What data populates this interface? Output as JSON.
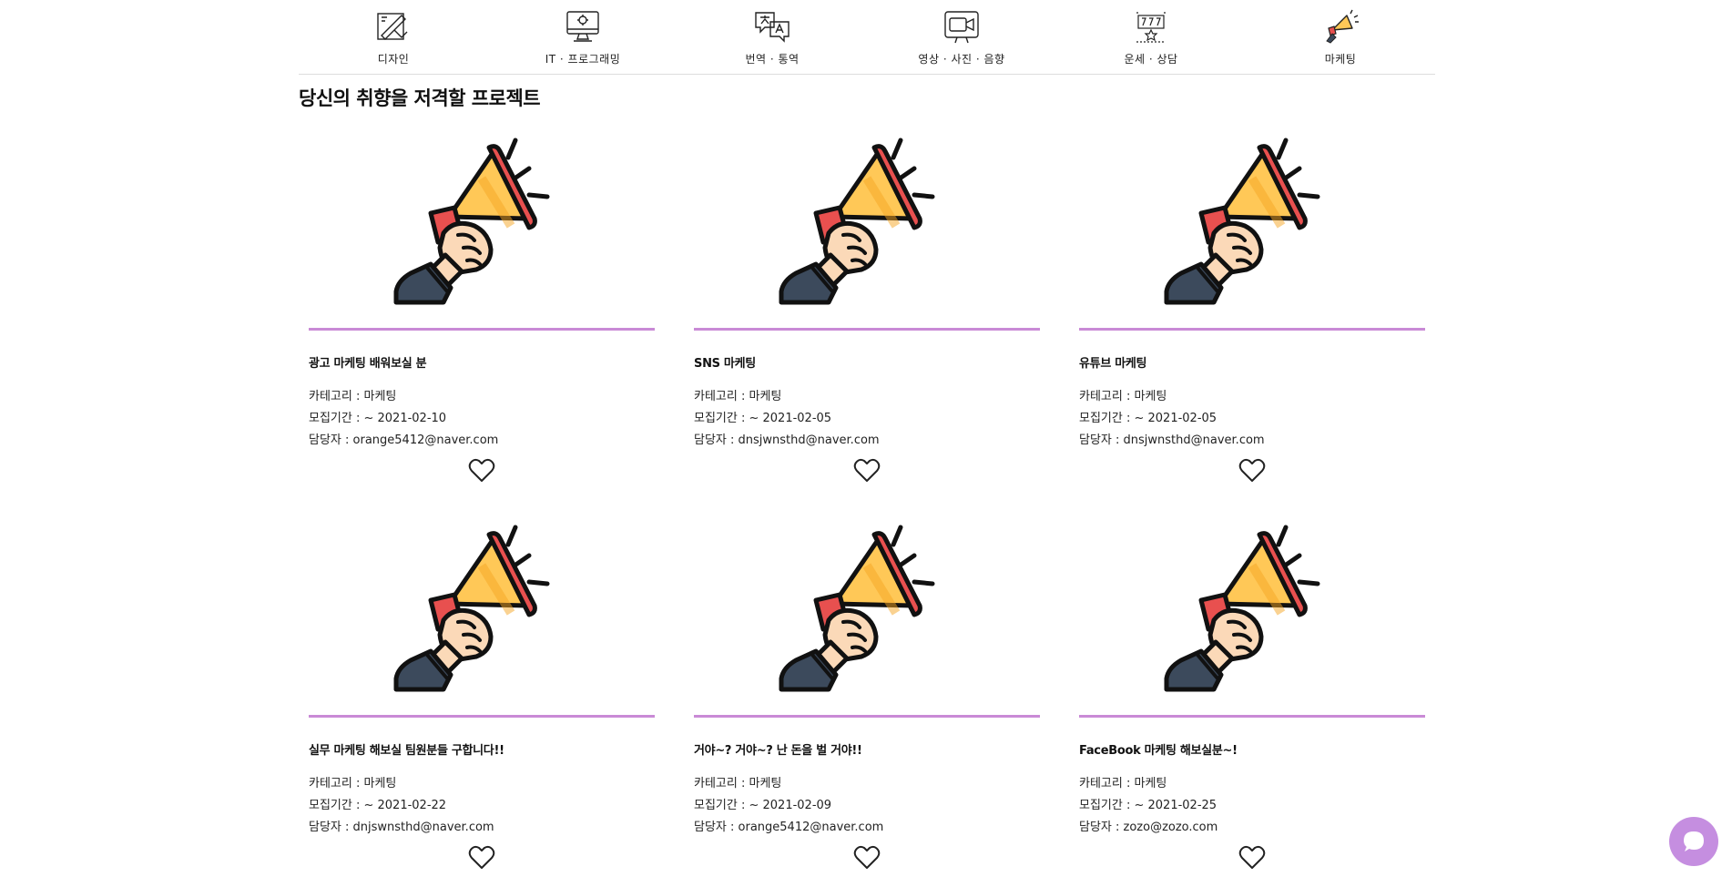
{
  "nav": {
    "categories": [
      {
        "label": "디자인",
        "icon": "design-icon"
      },
      {
        "label": "IT · 프로그래밍",
        "icon": "computer-icon"
      },
      {
        "label": "번역 · 통역",
        "icon": "translate-icon"
      },
      {
        "label": "영상 · 사진 · 음향",
        "icon": "video-camera-icon"
      },
      {
        "label": "운세 · 상담",
        "icon": "fortune-icon"
      },
      {
        "label": "마케팅",
        "icon": "megaphone-icon"
      }
    ]
  },
  "section": {
    "title": "당신의 취향을 저격할 프로젝트"
  },
  "projects": [
    {
      "title": "광고 마케팅 배워보실 분",
      "category": "카테고리 : 마케팅",
      "period": "모집기간 : ~ 2021-02-10",
      "manager": "담당자 : orange5412@naver.com"
    },
    {
      "title": "SNS 마케팅",
      "category": "카테고리 : 마케팅",
      "period": "모집기간 : ~ 2021-02-05",
      "manager": "담당자 : dnsjwnsthd@naver.com"
    },
    {
      "title": "유튜브 마케팅",
      "category": "카테고리 : 마케팅",
      "period": "모집기간 : ~ 2021-02-05",
      "manager": "담당자 : dnsjwnsthd@naver.com"
    },
    {
      "title": "실무 마케팅 해보실 팀원분들 구합니다!!",
      "category": "카테고리 : 마케팅",
      "period": "모집기간 : ~ 2021-02-22",
      "manager": "담당자 : dnjswnsthd@naver.com"
    },
    {
      "title": "거야~? 거야~? 난 돈을 벌 거야!!",
      "category": "카테고리 : 마케팅",
      "period": "모집기간 : ~ 2021-02-09",
      "manager": "담당자 : orange5412@naver.com"
    },
    {
      "title": "FaceBook 마케팅 해보실분~!",
      "category": "카테고리 : 마케팅",
      "period": "모집기간 : ~ 2021-02-25",
      "manager": "담당자 : zozo@zozo.com"
    }
  ],
  "card_image_icon": "megaphone-illustration",
  "like_icon": "heart-outline-icon",
  "chat": {
    "icon": "chat-bubble-icon"
  },
  "colors": {
    "divider": "#c98ad6",
    "chat_button": "#c58ee0",
    "megaphone_body": "#ffc857",
    "megaphone_red": "#e8504f"
  }
}
